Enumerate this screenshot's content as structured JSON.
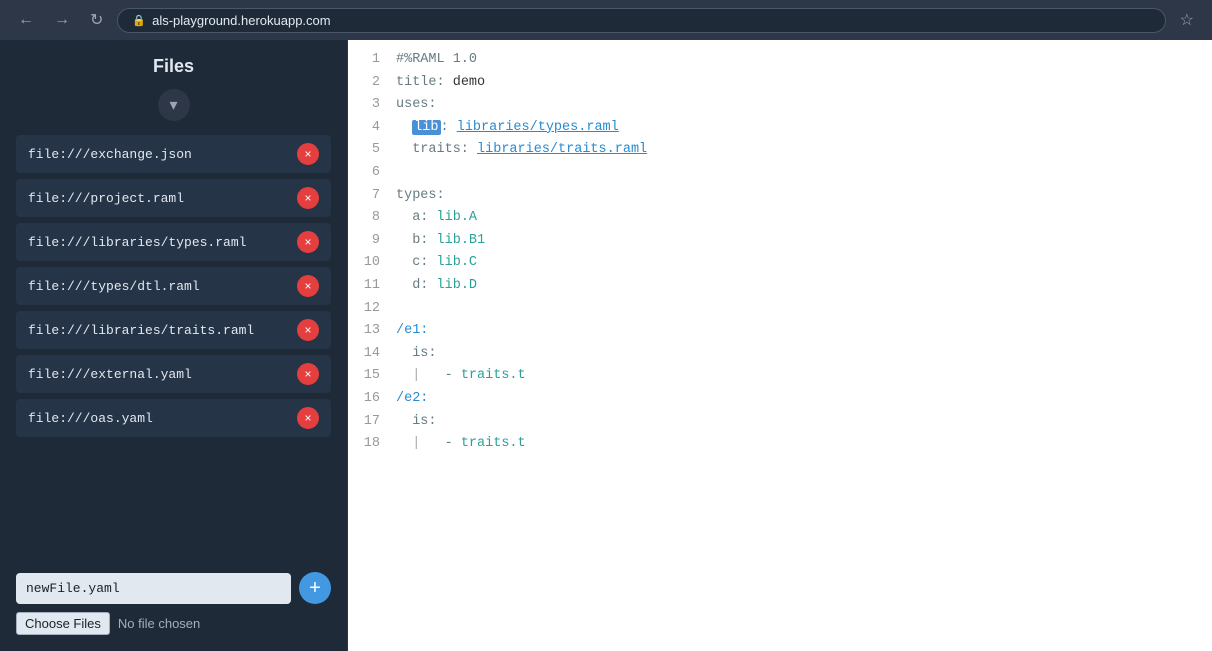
{
  "browser": {
    "url": "als-playground.herokuapp.com",
    "back_label": "←",
    "forward_label": "→",
    "reload_label": "↻",
    "star_label": "☆"
  },
  "sidebar": {
    "title": "Files",
    "collapse_icon": "▾",
    "files": [
      {
        "name": "file:///exchange.json"
      },
      {
        "name": "file:///project.raml"
      },
      {
        "name": "file:///libraries/types.raml"
      },
      {
        "name": "file:///types/dtl.raml"
      },
      {
        "name": "file:///libraries/traits.raml"
      },
      {
        "name": "file:///external.yaml"
      },
      {
        "name": "file:///oas.yaml"
      }
    ],
    "remove_icon": "×",
    "new_file_placeholder": "newFile.yaml",
    "add_icon": "+",
    "choose_files_label": "Choose Files",
    "no_file_label": "No file chosen"
  },
  "editor": {
    "lines": [
      {
        "num": 1,
        "content": "#%RAML 1.0",
        "type": "comment"
      },
      {
        "num": 2,
        "content": "title: demo",
        "type": "normal"
      },
      {
        "num": 3,
        "content": "uses:",
        "type": "key"
      },
      {
        "num": 4,
        "content": "  lib: libraries/types.raml",
        "type": "uses-lib"
      },
      {
        "num": 5,
        "content": "  traits: libraries/traits.raml",
        "type": "uses-traits"
      },
      {
        "num": 6,
        "content": "",
        "type": "empty"
      },
      {
        "num": 7,
        "content": "types:",
        "type": "key"
      },
      {
        "num": 8,
        "content": "  a: lib.A",
        "type": "type-entry"
      },
      {
        "num": 9,
        "content": "  b: lib.B1",
        "type": "type-entry"
      },
      {
        "num": 10,
        "content": "  c: lib.C",
        "type": "type-entry"
      },
      {
        "num": 11,
        "content": "  d: lib.D",
        "type": "type-entry"
      },
      {
        "num": 12,
        "content": "",
        "type": "empty"
      },
      {
        "num": 13,
        "content": "/e1:",
        "type": "endpoint"
      },
      {
        "num": 14,
        "content": "  is:",
        "type": "key-indent"
      },
      {
        "num": 15,
        "content": "    - traits.t",
        "type": "list-item"
      },
      {
        "num": 16,
        "content": "/e2:",
        "type": "endpoint"
      },
      {
        "num": 17,
        "content": "  is:",
        "type": "key-indent"
      },
      {
        "num": 18,
        "content": "    - traits.t",
        "type": "list-item"
      }
    ]
  }
}
